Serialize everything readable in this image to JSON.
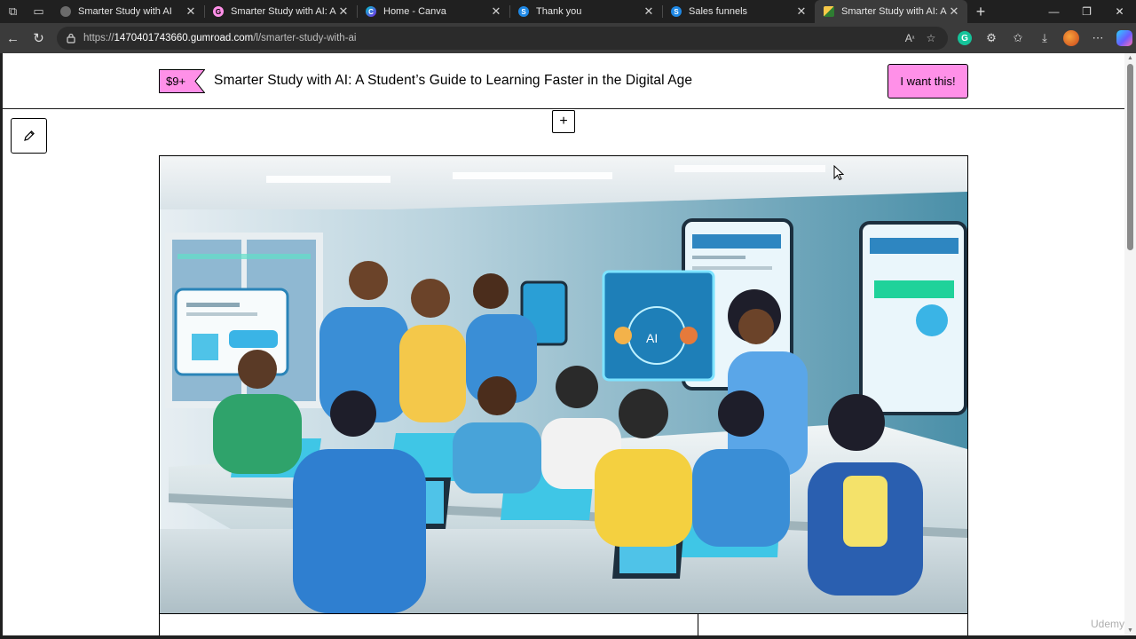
{
  "browser": {
    "tabs": [
      {
        "title": "Smarter Study with AI",
        "favicon": "gumroad-gray-icon",
        "active": false
      },
      {
        "title": "Smarter Study with AI: A Stud",
        "favicon": "gumroad-pink-icon",
        "active": false
      },
      {
        "title": "Home - Canva",
        "favicon": "canva-icon",
        "active": false
      },
      {
        "title": "Thank you",
        "favicon": "systeme-icon",
        "active": false
      },
      {
        "title": "Sales funnels",
        "favicon": "systeme-icon",
        "active": false
      },
      {
        "title": "Smarter Study with AI: A Stud",
        "favicon": "gumroad-yellow-icon",
        "active": true
      }
    ],
    "url_prefix": "https://",
    "url_host": "1470401743660.gumroad.com",
    "url_path": "/l/smarter-study-with-ai"
  },
  "product": {
    "price": "$9+",
    "title": "Smarter Study with AI: A Student’s Guide to Learning Faster in the Digital Age",
    "buy_label": "I want this!",
    "accent_color": "#ff90e8"
  },
  "editor": {
    "edit_icon": "pencil-icon",
    "add_label": "+"
  },
  "watermark": "Udemy"
}
